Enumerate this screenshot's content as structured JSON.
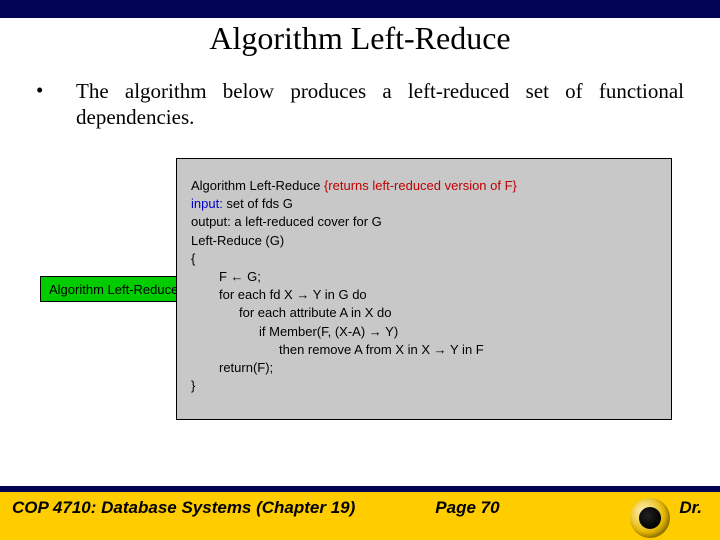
{
  "title": "Algorithm Left-Reduce",
  "bullet": "•",
  "body": "The algorithm below produces a left-reduced set of functional dependencies.",
  "backbox": "Algorithm Left-Reduce",
  "algo": {
    "l1a": "Algorithm Left-Reduce  ",
    "l1b": "{returns left-reduced version of F}",
    "l2a": "input:",
    "l2b": "  set of fds G",
    "l3": "output:  a left-reduced cover for G",
    "l4": "Left-Reduce (G)",
    "l5": "{",
    "l6": "F ← G;",
    "l7": "for each fd X → Y in G do",
    "l8": "for each attribute A in X do",
    "l9": "if Member(F, (X-A) → Y)",
    "l10": "then remove A from X in X → Y in F",
    "l11": "return(F);",
    "l12": "}"
  },
  "footer": {
    "course": "COP 4710: Database Systems  (Chapter 19)",
    "page": "Page 70",
    "dr": "Dr."
  }
}
